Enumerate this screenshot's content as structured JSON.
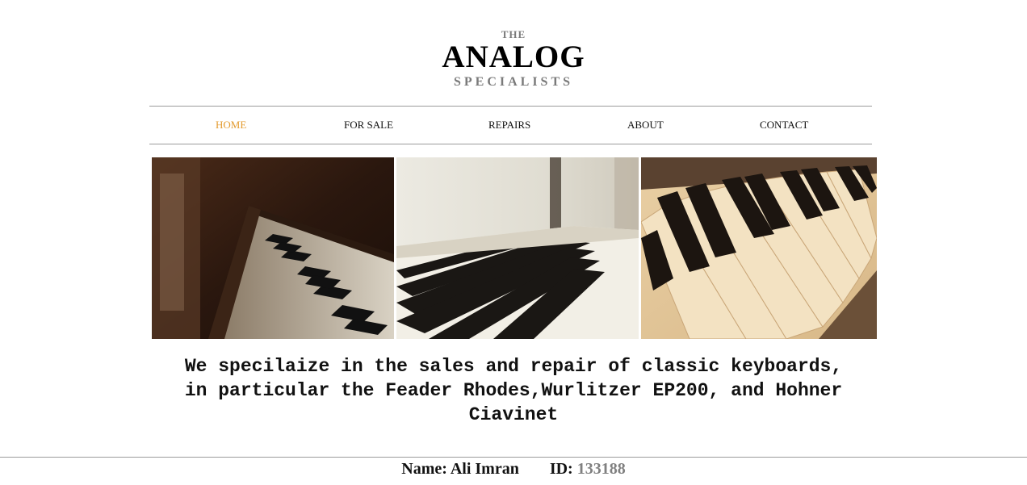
{
  "logo": {
    "the": "THE",
    "main": "ANALOG",
    "sub": "SPECIALISTS"
  },
  "nav": {
    "items": [
      {
        "label": "HOME",
        "active": true
      },
      {
        "label": "FOR SALE",
        "active": false
      },
      {
        "label": "REPAIRS",
        "active": false
      },
      {
        "label": "ABOUT",
        "active": false
      },
      {
        "label": "CONTACT",
        "active": false
      }
    ]
  },
  "hero": {
    "images": [
      "piano-keys-dark-photo",
      "piano-keys-light-photo",
      "piano-keys-sepia-photo"
    ]
  },
  "tagline": {
    "line1": "We specilaize in the sales and repair of classic keyboards,",
    "line2": "in particular the Feader Rhodes,Wurlitzer EP200, and Hohner",
    "line3": "Ciavinet"
  },
  "footer": {
    "name_label": "Name:",
    "name_value": "Ali Imran",
    "id_label": "ID:",
    "id_value": "133188"
  },
  "colors": {
    "accent": "#e39a2d",
    "muted": "#7a7a7a",
    "rule": "#9b9b9b"
  }
}
